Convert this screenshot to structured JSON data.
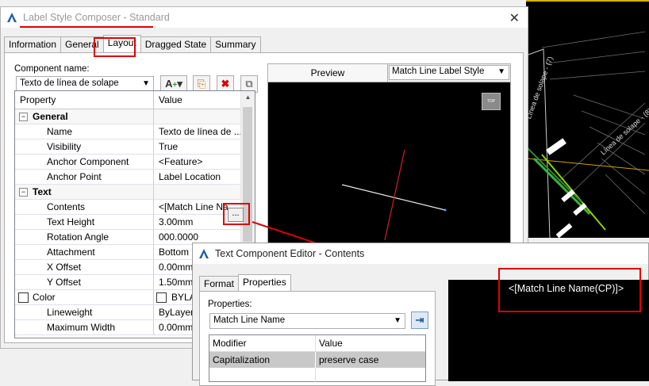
{
  "main_dialog": {
    "title": "Label Style Composer - Standard",
    "close": "✕",
    "tabs": [
      "Information",
      "General",
      "Layout",
      "Dragged State",
      "Summary"
    ],
    "active_tab": "Layout",
    "component_name_label": "Component name:",
    "component_name_value": "Texto de línea de solape",
    "grid": {
      "headers": [
        "Property",
        "Value"
      ],
      "rows": [
        {
          "type": "category",
          "name": "General",
          "value": ""
        },
        {
          "type": "prop",
          "name": "Name",
          "value": "Texto de línea de ..."
        },
        {
          "type": "prop",
          "name": "Visibility",
          "value": "True"
        },
        {
          "type": "prop",
          "name": "Anchor Component",
          "value": "<Feature>"
        },
        {
          "type": "prop",
          "name": "Anchor Point",
          "value": "Label Location"
        },
        {
          "type": "category",
          "name": "Text",
          "value": ""
        },
        {
          "type": "prop",
          "name": "Contents",
          "value": "<[Match Line Na"
        },
        {
          "type": "prop",
          "name": "Text Height",
          "value": "3.00mm"
        },
        {
          "type": "prop",
          "name": "Rotation Angle",
          "value": "000.0000"
        },
        {
          "type": "prop",
          "name": "Attachment",
          "value": "Bottom"
        },
        {
          "type": "prop",
          "name": "X Offset",
          "value": "0.00mm"
        },
        {
          "type": "prop",
          "name": "Y Offset",
          "value": "1.50mm"
        },
        {
          "type": "prop",
          "name": "Color",
          "value": "BYLA"
        },
        {
          "type": "prop",
          "name": "Lineweight",
          "value": "ByLayer"
        },
        {
          "type": "prop",
          "name": "Maximum Width",
          "value": "0.00mm"
        }
      ],
      "ellipsis_button": "..."
    },
    "preview": {
      "header": "Preview",
      "style_select": "Match Line Label Style",
      "view_cube": "TOP"
    }
  },
  "cad_labels": [
    "Línea de solape - (7)",
    "Línea de solape - (8)"
  ],
  "editor": {
    "title": "Text Component Editor - Contents",
    "tabs": [
      "Format",
      "Properties"
    ],
    "active_tab": "Properties",
    "properties_label": "Properties:",
    "properties_value": "Match Line Name",
    "grid_headers": [
      "Modifier",
      "Value"
    ],
    "grid_rows": [
      {
        "modifier": "Capitalization",
        "value": "preserve case"
      }
    ],
    "preview_text": "<[Match Line Name(CP)]>"
  },
  "colors": {
    "highlight_red": "#e00000",
    "autocad_blue": "#1f5fa8",
    "selected_row": "#c8c8c8"
  }
}
